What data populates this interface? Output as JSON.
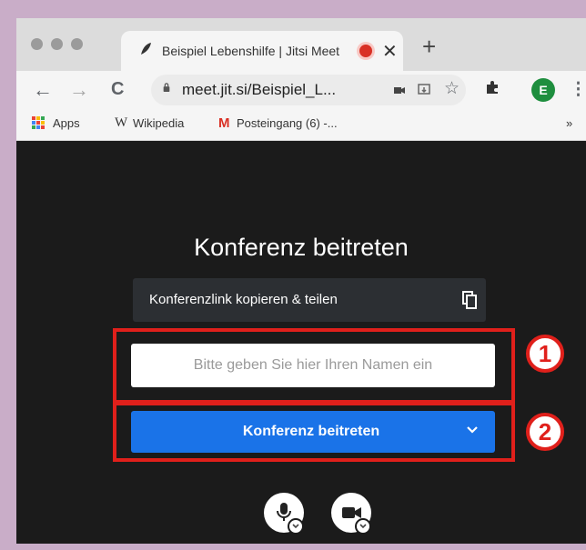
{
  "browser": {
    "tab": {
      "title": "Beispiel Lebenshilfe | Jitsi Meet",
      "close": "✕",
      "new_tab": "+"
    },
    "nav": {
      "back": "←",
      "forward": "→",
      "reload": "C"
    },
    "address_bar": {
      "url": "meet.jit.si/Beispiel_L..."
    },
    "avatar_initial": "E",
    "menu": "⋮",
    "bookmarks": {
      "apps": "Apps",
      "wikipedia": "Wikipedia",
      "gmail": "Posteingang (6) -...",
      "more": "»"
    }
  },
  "page": {
    "title": "Konferenz beitreten",
    "copy_link": "Konferenzlink kopieren & teilen",
    "name_placeholder": "Bitte geben Sie hier Ihren Namen ein",
    "join_button": "Konferenz beitreten"
  },
  "annotations": {
    "marker_1": "1",
    "marker_2": "2",
    "highlight_color": "#e0201b"
  },
  "colors": {
    "join_button": "#1a73e8",
    "page_background": "#1b1b1b",
    "outer_border": "#c9adc8"
  }
}
